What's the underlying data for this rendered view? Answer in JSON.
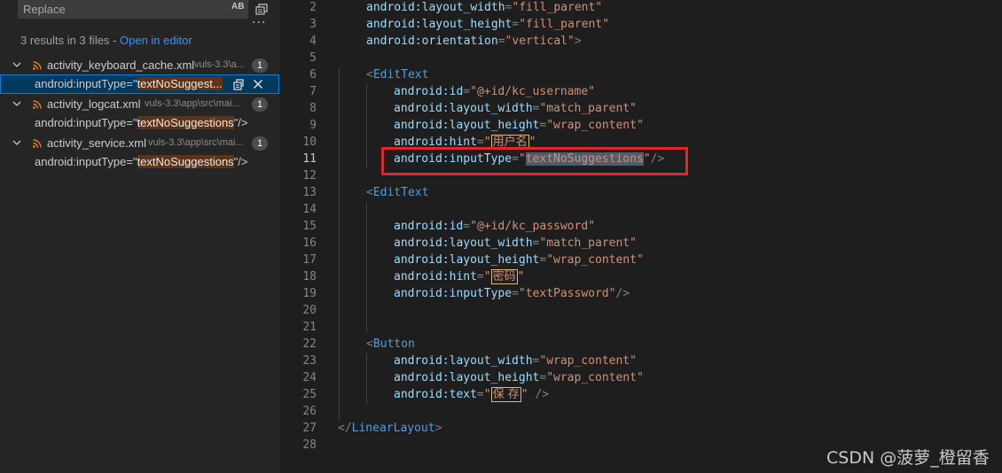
{
  "search": {
    "replace_placeholder": "Replace",
    "preserve_case_label": "AB",
    "results_count_text": "3 results in 3 files",
    "results_separator": " - ",
    "open_in_editor_label": "Open in editor",
    "more_actions_label": "···"
  },
  "results": [
    {
      "file": "activity_keyboard_cache.xml",
      "path": "vuls-3.3\\a...",
      "count": "1",
      "match_prefix": "android:inputType=\"",
      "match_highlight": "textNoSuggest...",
      "match_suffix": ""
    },
    {
      "file": "activity_logcat.xml",
      "path": "vuls-3.3\\app\\src\\mai...",
      "count": "1",
      "match_prefix": "android:inputType=\"",
      "match_highlight": "textNoSuggestions",
      "match_suffix": "\"/>"
    },
    {
      "file": "activity_service.xml",
      "path": "vuls-3.3\\app\\src\\mai...",
      "count": "1",
      "match_prefix": "android:inputType=\"",
      "match_highlight": "textNoSuggestions",
      "match_suffix": "\"/>"
    }
  ],
  "editor": {
    "lines": [
      {
        "n": "2",
        "attr": "android:layout_width",
        "val": "fill_parent"
      },
      {
        "n": "3",
        "attr": "android:layout_height",
        "val": "fill_parent"
      },
      {
        "n": "4",
        "attr": "android:orientation",
        "val": "vertical",
        "close": ">"
      },
      {
        "n": "5"
      },
      {
        "n": "6",
        "tag": "EditText"
      },
      {
        "n": "7",
        "attr": "android:id",
        "val": "@+id/kc_username"
      },
      {
        "n": "8",
        "attr": "android:layout_width",
        "val": "match_parent"
      },
      {
        "n": "9",
        "attr": "android:layout_height",
        "val": "wrap_content"
      },
      {
        "n": "10",
        "attr": "android:hint",
        "cjk": "用户名"
      },
      {
        "n": "11",
        "attr": "android:inputType",
        "val": "textNoSuggestions",
        "close": "/>"
      },
      {
        "n": "12"
      },
      {
        "n": "13",
        "tag": "EditText"
      },
      {
        "n": "14"
      },
      {
        "n": "15",
        "attr": "android:id",
        "val": "@+id/kc_password"
      },
      {
        "n": "16",
        "attr": "android:layout_width",
        "val": "match_parent"
      },
      {
        "n": "17",
        "attr": "android:layout_height",
        "val": "wrap_content"
      },
      {
        "n": "18",
        "attr": "android:hint",
        "cjk": "密码"
      },
      {
        "n": "19",
        "attr": "android:inputType",
        "val": "textPassword",
        "close": "/>"
      },
      {
        "n": "20"
      },
      {
        "n": "21"
      },
      {
        "n": "22",
        "tag": "Button"
      },
      {
        "n": "23",
        "attr": "android:layout_width",
        "val": "wrap_content"
      },
      {
        "n": "24",
        "attr": "android:layout_height",
        "val": "wrap_content"
      },
      {
        "n": "25",
        "attr": "android:text",
        "cjk": "保 存",
        "close": " />"
      },
      {
        "n": "26"
      },
      {
        "n": "27",
        "closetag": "LinearLayout"
      },
      {
        "n": "28"
      }
    ]
  },
  "watermark": "CSDN @菠萝_橙留香",
  "colors": {
    "sidebar_bg": "#252526",
    "editor_bg": "#1e1e1e",
    "selection": "#04395e",
    "match_highlight": "#613214",
    "link": "#3794ff",
    "annotation_box": "#e0262a"
  }
}
